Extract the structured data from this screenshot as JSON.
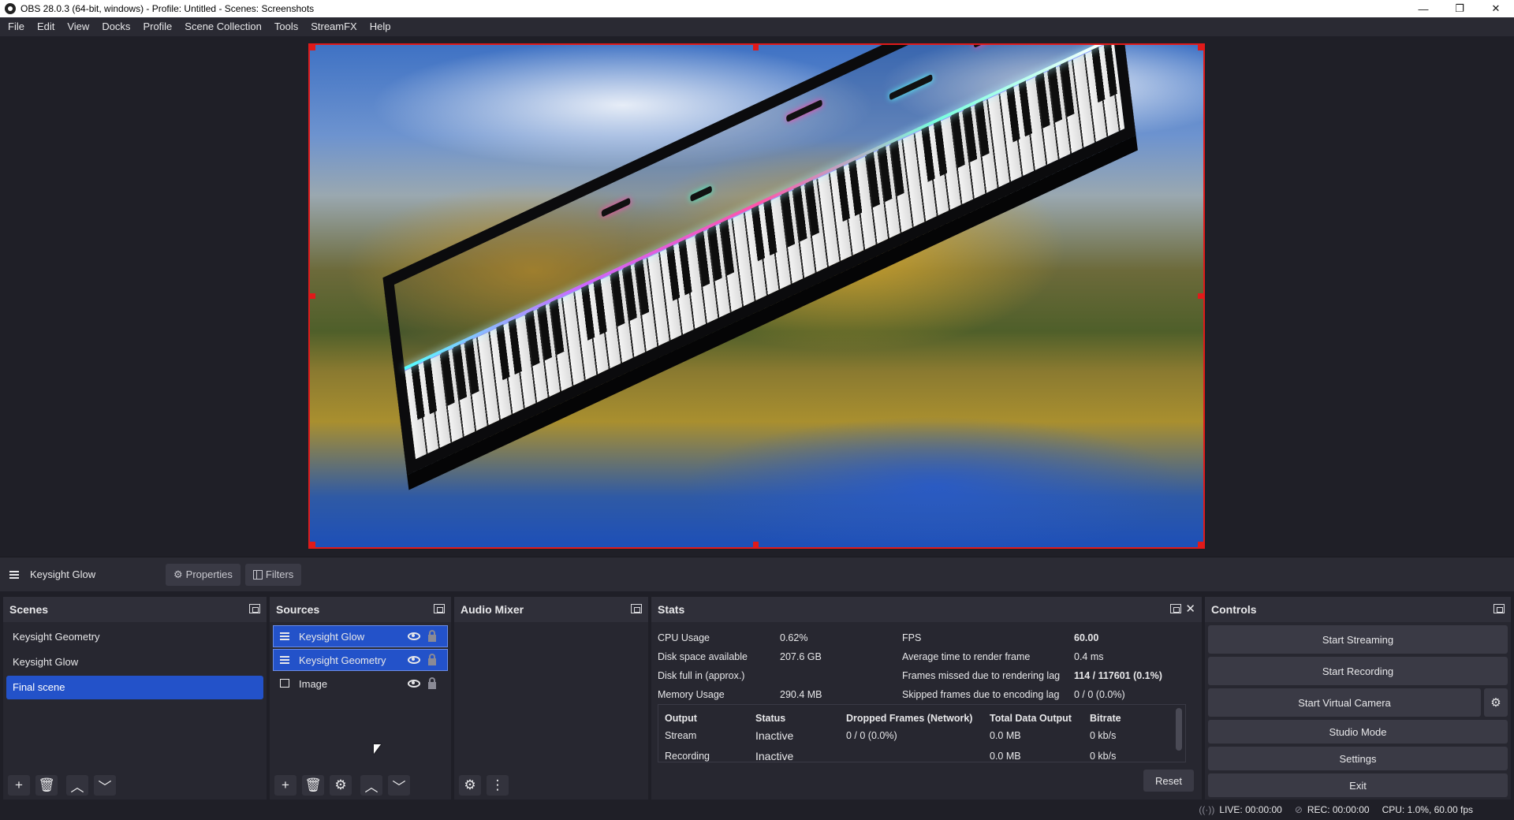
{
  "window": {
    "title": "OBS 28.0.3 (64-bit, windows) - Profile: Untitled - Scenes: Screenshots",
    "minimize": "—",
    "restore": "❐",
    "close": "✕"
  },
  "menu": [
    "File",
    "Edit",
    "View",
    "Docks",
    "Profile",
    "Scene Collection",
    "Tools",
    "StreamFX",
    "Help"
  ],
  "source_toolbar": {
    "current_source": "Keysight Glow",
    "properties_label": "Properties",
    "filters_label": "Filters"
  },
  "scenes": {
    "title": "Scenes",
    "items": [
      "Keysight Geometry",
      "Keysight Glow",
      "Final scene"
    ],
    "selected": "Final scene"
  },
  "sources": {
    "title": "Sources",
    "items": [
      {
        "label": "Keysight Glow",
        "icon": "list-icon",
        "selected": true
      },
      {
        "label": "Keysight Geometry",
        "icon": "list-icon",
        "selected": true
      },
      {
        "label": "Image",
        "icon": "image-icon",
        "selected": false
      }
    ]
  },
  "audio_mixer": {
    "title": "Audio Mixer"
  },
  "stats": {
    "title": "Stats",
    "rows": [
      {
        "k1": "CPU Usage",
        "v1": "0.62%",
        "k2": "FPS",
        "v2": "60.00"
      },
      {
        "k1": "Disk space available",
        "v1": "207.6 GB",
        "k2": "Average time to render frame",
        "v2": "0.4 ms"
      },
      {
        "k1": "Disk full in (approx.)",
        "v1": "",
        "k2": "Frames missed due to rendering lag",
        "v2": "114 / 117601 (0.1%)"
      },
      {
        "k1": "Memory Usage",
        "v1": "290.4 MB",
        "k2": "Skipped frames due to encoding lag",
        "v2": "0 / 0 (0.0%)"
      }
    ],
    "output_headers": [
      "Output",
      "Status",
      "Dropped Frames (Network)",
      "Total Data Output",
      "Bitrate"
    ],
    "output_rows": [
      [
        "Stream",
        "Inactive",
        "0 / 0 (0.0%)",
        "0.0 MB",
        "0 kb/s"
      ],
      [
        "Recording",
        "Inactive",
        "",
        "0.0 MB",
        "0 kb/s"
      ]
    ],
    "reset_label": "Reset"
  },
  "controls": {
    "title": "Controls",
    "start_streaming": "Start Streaming",
    "start_recording": "Start Recording",
    "start_virtual_camera": "Start Virtual Camera",
    "studio_mode": "Studio Mode",
    "settings": "Settings",
    "exit": "Exit"
  },
  "statusbar": {
    "live": "LIVE: 00:00:00",
    "rec": "REC: 00:00:00",
    "cpu": "CPU: 1.0%, 60.00 fps"
  },
  "colors": {
    "selection": "#2352c9",
    "bounding_box": "#e01a1a",
    "panel_bg": "#272730"
  }
}
